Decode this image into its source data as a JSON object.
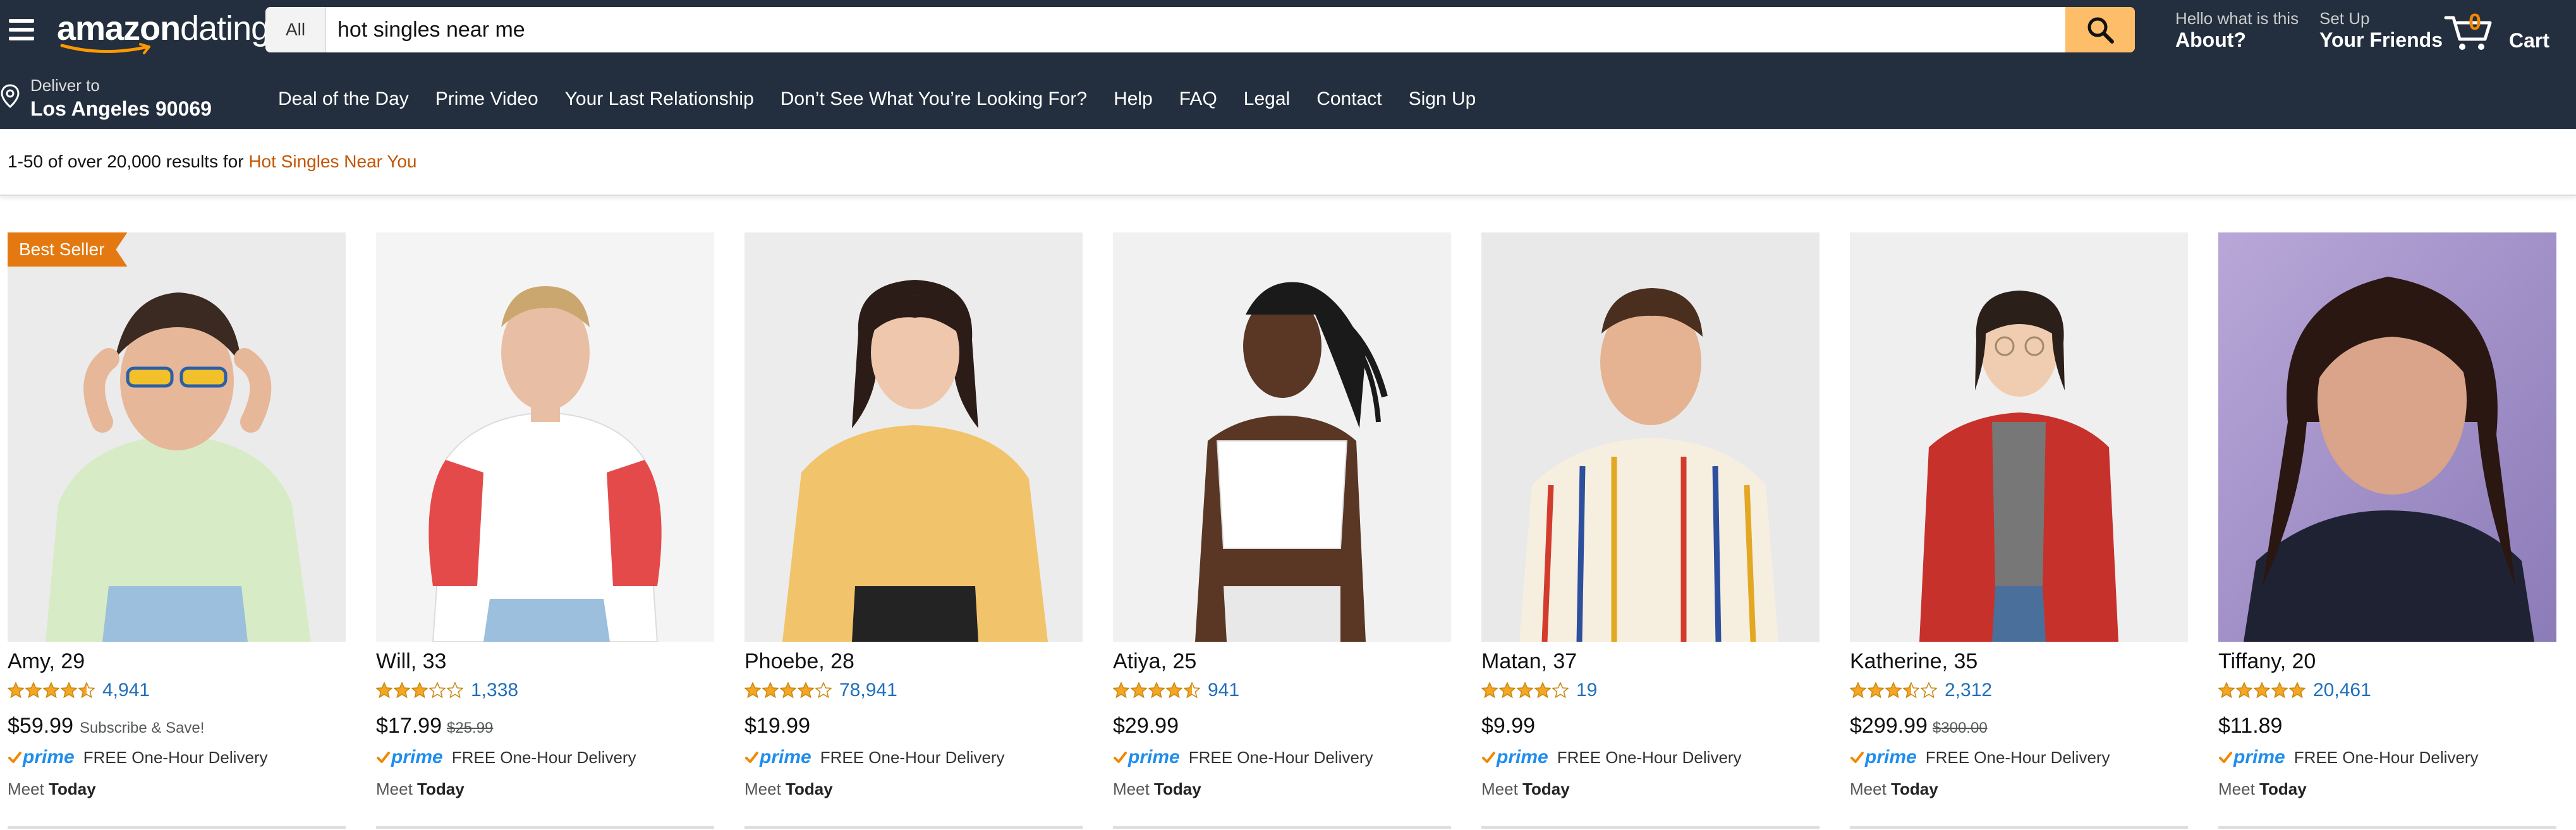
{
  "header": {
    "logo_main": "amazon",
    "logo_sub": "dating",
    "search": {
      "category": "All",
      "query": "hot singles near me"
    },
    "account": {
      "small": "Hello what is this",
      "bold": "About?"
    },
    "friends": {
      "small": "Set Up",
      "bold": "Your Friends"
    },
    "cart": {
      "count": "0",
      "label": "Cart"
    }
  },
  "subnav": {
    "deliver_small": "Deliver to",
    "deliver_bold": "Los Angeles 90069",
    "links": [
      "Deal of the Day",
      "Prime Video",
      "Your Last Relationship",
      "Don’t See What You’re Looking For?",
      "Help",
      "FAQ",
      "Legal",
      "Contact",
      "Sign Up"
    ]
  },
  "results": {
    "prefix": "1-50 of over 20,000 results for ",
    "term": "Hot Singles Near You"
  },
  "colors": {
    "header_bg": "#232f3e",
    "search_button": "#febd69",
    "badge": "#e47911",
    "link_blue": "#1f6fbd",
    "prime_blue": "#1f8ded",
    "star": "#f5a623",
    "results_term": "#c45500"
  },
  "products": [
    {
      "name": "Amy, 29",
      "badge": "Best Seller",
      "stars": 4.5,
      "reviews": "4,941",
      "price": "$59.99",
      "old_price": "",
      "note": "Subscribe & Save!",
      "prime": "prime",
      "delivery": "FREE One-Hour Delivery",
      "meet_prefix": "Meet ",
      "meet_day": "Today"
    },
    {
      "name": "Will, 33",
      "badge": "",
      "stars": 3,
      "reviews": "1,338",
      "price": "$17.99",
      "old_price": "$25.99",
      "note": "",
      "prime": "prime",
      "delivery": "FREE One-Hour Delivery",
      "meet_prefix": "Meet ",
      "meet_day": "Today"
    },
    {
      "name": "Phoebe, 28",
      "badge": "",
      "stars": 4,
      "reviews": "78,941",
      "price": "$19.99",
      "old_price": "",
      "note": "",
      "prime": "prime",
      "delivery": "FREE One-Hour Delivery",
      "meet_prefix": "Meet ",
      "meet_day": "Today"
    },
    {
      "name": "Atiya, 25",
      "badge": "",
      "stars": 4.5,
      "reviews": "941",
      "price": "$29.99",
      "old_price": "",
      "note": "",
      "prime": "prime",
      "delivery": "FREE One-Hour Delivery",
      "meet_prefix": "Meet ",
      "meet_day": "Today"
    },
    {
      "name": "Matan, 37",
      "badge": "",
      "stars": 4,
      "reviews": "19",
      "price": "$9.99",
      "old_price": "",
      "note": "",
      "prime": "prime",
      "delivery": "FREE One-Hour Delivery",
      "meet_prefix": "Meet ",
      "meet_day": "Today"
    },
    {
      "name": "Katherine, 35",
      "badge": "",
      "stars": 3.5,
      "reviews": "2,312",
      "price": "$299.99",
      "old_price": "$300.00",
      "note": "",
      "prime": "prime",
      "delivery": "FREE One-Hour Delivery",
      "meet_prefix": "Meet ",
      "meet_day": "Today"
    },
    {
      "name": "Tiffany, 20",
      "badge": "",
      "stars": 5,
      "reviews": "20,461",
      "price": "$11.89",
      "old_price": "",
      "note": "",
      "prime": "prime",
      "delivery": "FREE One-Hour Delivery",
      "meet_prefix": "Meet ",
      "meet_day": "Today"
    }
  ]
}
